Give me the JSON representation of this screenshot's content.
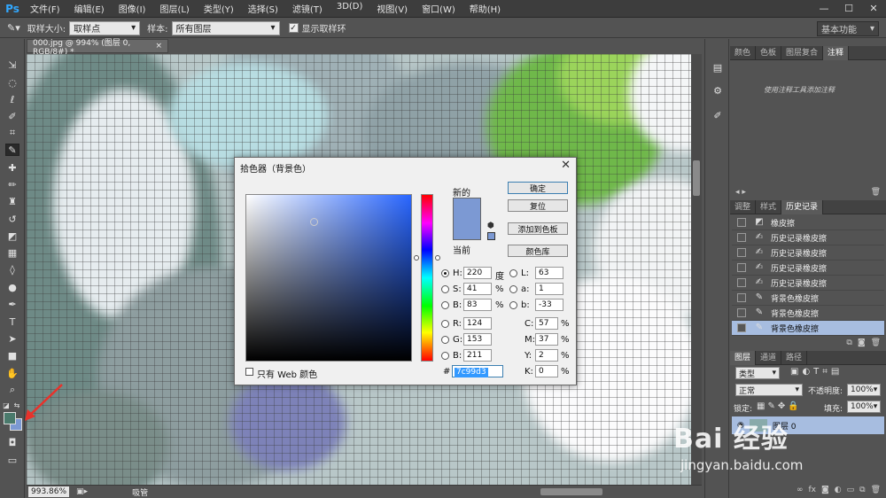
{
  "app": {
    "logo": "Ps"
  },
  "menu": [
    "文件(F)",
    "编辑(E)",
    "图像(I)",
    "图层(L)",
    "类型(Y)",
    "选择(S)",
    "滤镜(T)",
    "3D(D)",
    "视图(V)",
    "窗口(W)",
    "帮助(H)"
  ],
  "window_controls": [
    "—",
    "☐",
    "✕"
  ],
  "options": {
    "sample_size_label": "取样大小:",
    "sample_size_value": "取样点",
    "sample_label": "样本:",
    "sample_value": "所有图层",
    "show_ring_label": "显示取样环",
    "workspace": "基本功能"
  },
  "document": {
    "tab_title": "000.jpg @ 994% (图层 0, RGB/8#) *",
    "tab_close": "×"
  },
  "status": {
    "zoom": "993.86%",
    "tool": "吸管"
  },
  "colors": {
    "foreground": "#4a7a6c",
    "background": "#7c99d3"
  },
  "panels": {
    "top_tabs": [
      "颜色",
      "色板",
      "图层复合",
      "注释"
    ],
    "top_hint": "使用注释工具添加注释",
    "history_tabs": [
      "调整",
      "样式",
      "历史记录"
    ],
    "history_items": [
      {
        "label": "橡皮擦",
        "icon": "eraser-icon"
      },
      {
        "label": "历史记录橡皮擦",
        "icon": "history-brush-icon"
      },
      {
        "label": "历史记录橡皮擦",
        "icon": "history-brush-icon"
      },
      {
        "label": "历史记录橡皮擦",
        "icon": "history-brush-icon"
      },
      {
        "label": "历史记录橡皮擦",
        "icon": "history-brush-icon"
      },
      {
        "label": "背景色橡皮擦",
        "icon": "bg-eraser-icon"
      },
      {
        "label": "背景色橡皮擦",
        "icon": "bg-eraser-icon"
      },
      {
        "label": "背景色橡皮擦",
        "icon": "bg-eraser-icon"
      }
    ],
    "layers_tabs": [
      "图层",
      "通道",
      "路径"
    ],
    "layer_filter": "类型",
    "blend_mode": "正常",
    "opacity_label": "不透明度:",
    "opacity": "100%",
    "lock_label": "锁定:",
    "fill_label": "填充:",
    "fill": "100%",
    "layer_name": "图层 0"
  },
  "picker": {
    "title": "拾色器（背景色）",
    "new_label": "新的",
    "current_label": "当前",
    "buttons": {
      "ok": "确定",
      "reset": "复位",
      "add": "添加到色板",
      "library": "颜色库"
    },
    "H": "220",
    "S": "41",
    "B": "83",
    "R": "124",
    "G": "153",
    "Bb": "211",
    "L": "63",
    "a": "1",
    "b": "-33",
    "C": "57",
    "M": "37",
    "Y": "2",
    "K": "0",
    "hex": "7c99d3",
    "web_only": "只有 Web 颜色",
    "units": {
      "deg": "度",
      "pct": "%"
    }
  },
  "watermark": {
    "main": "Bai 经验",
    "sub": "jingyan.baidu.com"
  }
}
